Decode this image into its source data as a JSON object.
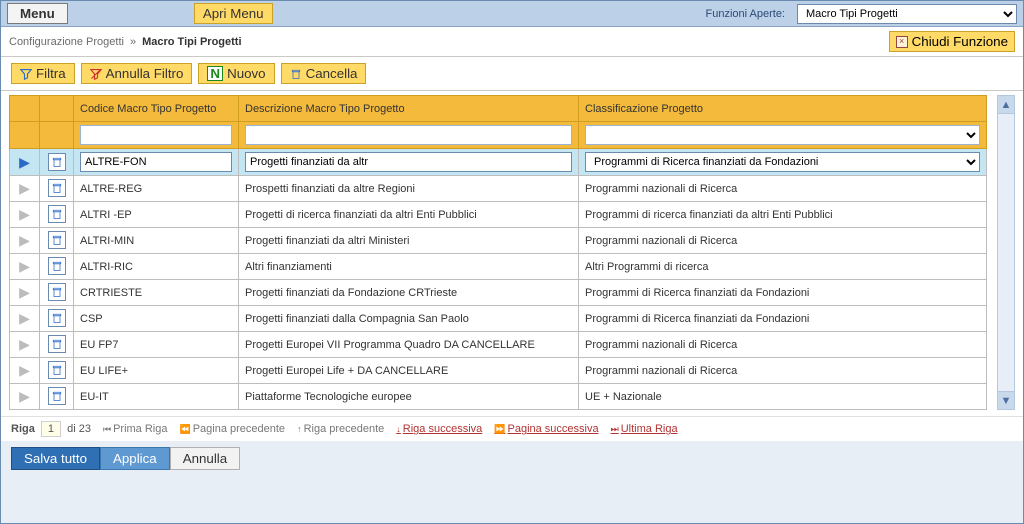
{
  "header": {
    "menu_label": "Menu",
    "apri_menu_label": "Apri Menu",
    "funzioni_aperte_label": "Funzioni Aperte:",
    "funzioni_aperte_value": "Macro Tipi Progetti"
  },
  "breadcrumb": {
    "path": "Configurazione Progetti",
    "sep": "»",
    "current": "Macro Tipi Progetti",
    "close_label": "Chiudi Funzione"
  },
  "toolbar": {
    "filtra": "Filtra",
    "annulla_filtro": "Annulla Filtro",
    "nuovo": "Nuovo",
    "cancella": "Cancella"
  },
  "grid": {
    "headers": {
      "code": "Codice Macro Tipo Progetto",
      "desc": "Descrizione Macro Tipo Progetto",
      "class": "Classificazione Progetto"
    },
    "filter": {
      "code": "",
      "desc": "",
      "class": ""
    },
    "selected_row": {
      "code": "ALTRE-FON",
      "desc": "Progetti finanziati da altr",
      "class": "Programmi di Ricerca finanziati da Fondazioni"
    },
    "rows": [
      {
        "code": "ALTRE-REG",
        "desc": "Prospetti finanziati da altre Regioni",
        "class": "Programmi nazionali di Ricerca"
      },
      {
        "code": "ALTRI -EP",
        "desc": "Progetti di ricerca finanziati da altri Enti Pubblici",
        "class": "Programmi di ricerca finanziati da altri Enti Pubblici"
      },
      {
        "code": "ALTRI-MIN",
        "desc": "Progetti finanziati da altri Ministeri",
        "class": "Programmi nazionali di Ricerca"
      },
      {
        "code": "ALTRI-RIC",
        "desc": "Altri finanziamenti",
        "class": "Altri Programmi di ricerca"
      },
      {
        "code": "CRTRIESTE",
        "desc": "Progetti finanziati da Fondazione CRTrieste",
        "class": "Programmi di Ricerca finanziati da Fondazioni"
      },
      {
        "code": "CSP",
        "desc": "Progetti finanziati dalla Compagnia San Paolo",
        "class": "Programmi di Ricerca finanziati da Fondazioni"
      },
      {
        "code": "EU FP7",
        "desc": "Progetti Europei VII Programma Quadro DA CANCELLARE",
        "class": "Programmi nazionali di Ricerca"
      },
      {
        "code": "EU LIFE+",
        "desc": "Progetti Europei Life + DA CANCELLARE",
        "class": "Programmi nazionali di Ricerca"
      },
      {
        "code": "EU-IT",
        "desc": "Piattaforme Tecnologiche europee",
        "class": "UE + Nazionale"
      }
    ]
  },
  "pager": {
    "riga_label": "Riga",
    "riga_value": "1",
    "di": "di",
    "total": "23",
    "first": "Prima Riga",
    "prev_page": "Pagina precedente",
    "prev_row": "Riga precedente",
    "next_row": "Riga successiva",
    "next_page": "Pagina successiva",
    "last": "Ultima Riga"
  },
  "actions": {
    "save_all": "Salva tutto",
    "apply": "Applica",
    "cancel": "Annulla"
  }
}
